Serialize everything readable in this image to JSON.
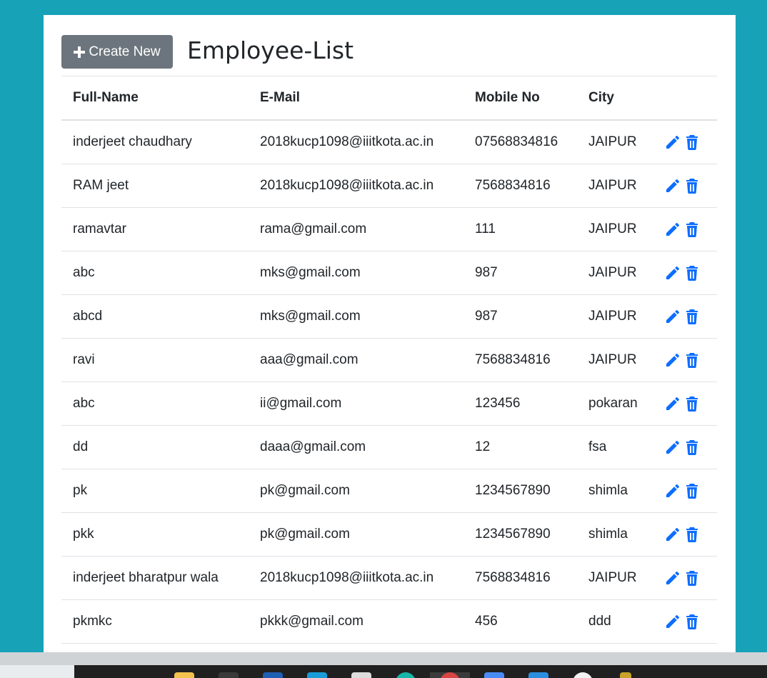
{
  "header": {
    "create_label": "Create New",
    "title": "Employee-List"
  },
  "table": {
    "columns": [
      "Full-Name",
      "E-Mail",
      "Mobile No",
      "City"
    ],
    "rows": [
      {
        "name": "inderjeet chaudhary",
        "email": "2018kucp1098@iiitkota.ac.in",
        "mobile": "07568834816",
        "city": "JAIPUR"
      },
      {
        "name": "RAM jeet",
        "email": "2018kucp1098@iiitkota.ac.in",
        "mobile": "7568834816",
        "city": "JAIPUR"
      },
      {
        "name": "ramavtar",
        "email": "rama@gmail.com",
        "mobile": "111",
        "city": "JAIPUR"
      },
      {
        "name": "abc",
        "email": "mks@gmail.com",
        "mobile": "987",
        "city": "JAIPUR"
      },
      {
        "name": "abcd",
        "email": "mks@gmail.com",
        "mobile": "987",
        "city": "JAIPUR"
      },
      {
        "name": "ravi",
        "email": "aaa@gmail.com",
        "mobile": "7568834816",
        "city": "JAIPUR"
      },
      {
        "name": "abc",
        "email": "ii@gmail.com",
        "mobile": "123456",
        "city": "pokaran"
      },
      {
        "name": "dd",
        "email": "daaa@gmail.com",
        "mobile": "12",
        "city": "fsa"
      },
      {
        "name": "pk",
        "email": "pk@gmail.com",
        "mobile": "1234567890",
        "city": "shimla"
      },
      {
        "name": "pkk",
        "email": "pk@gmail.com",
        "mobile": "1234567890",
        "city": "shimla"
      },
      {
        "name": "inderjeet bharatpur wala",
        "email": "2018kucp1098@iiitkota.ac.in",
        "mobile": "7568834816",
        "city": "JAIPUR"
      },
      {
        "name": "pkmkc",
        "email": "pkkk@gmail.com",
        "mobile": "456",
        "city": "ddd"
      }
    ]
  },
  "icons": {
    "create": "plus-icon",
    "edit": "pencil-icon",
    "delete": "trash-icon"
  },
  "colors": {
    "background": "#17a2b8",
    "button": "#6c757d",
    "action_icon": "#0d6efd"
  }
}
